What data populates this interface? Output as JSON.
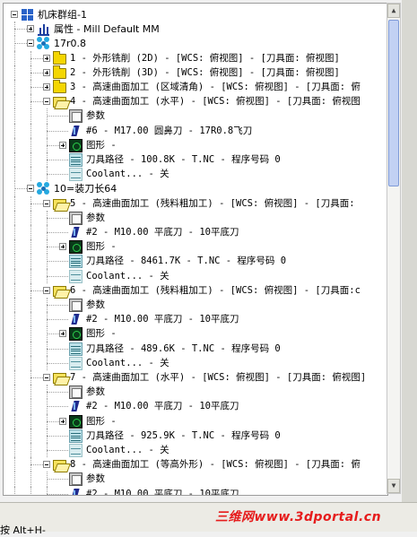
{
  "tree": {
    "rows": [
      {
        "level": 0,
        "toggle": "minus",
        "icon": "group",
        "label": "机床群组-1",
        "font": "sans"
      },
      {
        "level": 1,
        "toggle": "plus",
        "icon": "props",
        "label": "属性 - Mill Default MM",
        "font": "sans"
      },
      {
        "level": 1,
        "toggle": "minus",
        "icon": "tool",
        "label": "17r0.8",
        "font": "sans"
      },
      {
        "level": 2,
        "toggle": "plus",
        "icon": "folder",
        "label": "1 - 外形铣削 (2D) - [WCS: 俯视图] - [刀具面: 俯视图]"
      },
      {
        "level": 2,
        "toggle": "plus",
        "icon": "folder",
        "label": "2 - 外形铣削 (3D) - [WCS: 俯视图] - [刀具面: 俯视图]"
      },
      {
        "level": 2,
        "toggle": "plus",
        "icon": "folder",
        "label": "3 - 高速曲面加工 (区域清角) - [WCS: 俯视图] - [刀具面: 俯"
      },
      {
        "level": 2,
        "toggle": "minus",
        "icon": "folder-open",
        "label": "4 - 高速曲面加工 (水平) - [WCS: 俯视图] - [刀具面: 俯视图"
      },
      {
        "level": 3,
        "toggle": "none",
        "icon": "params",
        "label": "参数"
      },
      {
        "level": 3,
        "toggle": "none",
        "icon": "drill",
        "label": "#6 - M17.00 圆鼻刀 - 17R0.8飞刀"
      },
      {
        "level": 3,
        "toggle": "plus",
        "icon": "geom",
        "label": "图形 -"
      },
      {
        "level": 3,
        "toggle": "none",
        "icon": "path",
        "label": "刀具路径 - 100.8K - T.NC - 程序号码 0"
      },
      {
        "level": 3,
        "toggle": "none",
        "icon": "coolant",
        "label": "Coolant... - 关"
      },
      {
        "level": 1,
        "toggle": "minus",
        "icon": "tool",
        "label": "10=装刀长64",
        "font": "sans"
      },
      {
        "level": 2,
        "toggle": "minus",
        "icon": "folder-open",
        "label": "5 - 高速曲面加工 (残料粗加工) - [WCS: 俯视图] - [刀具面:"
      },
      {
        "level": 3,
        "toggle": "none",
        "icon": "params",
        "label": "参数"
      },
      {
        "level": 3,
        "toggle": "none",
        "icon": "drill",
        "label": "#2 - M10.00 平底刀 - 10平底刀"
      },
      {
        "level": 3,
        "toggle": "plus",
        "icon": "geom",
        "label": "图形 -"
      },
      {
        "level": 3,
        "toggle": "none",
        "icon": "path",
        "label": "刀具路径 - 8461.7K - T.NC - 程序号码 0"
      },
      {
        "level": 3,
        "toggle": "none",
        "icon": "coolant",
        "label": "Coolant... - 关"
      },
      {
        "level": 2,
        "toggle": "minus",
        "icon": "folder-open",
        "label": "6 - 高速曲面加工 (残料粗加工) - [WCS: 俯视图] - [刀具面:c"
      },
      {
        "level": 3,
        "toggle": "none",
        "icon": "params",
        "label": "参数"
      },
      {
        "level": 3,
        "toggle": "none",
        "icon": "drill",
        "label": "#2 - M10.00 平底刀 - 10平底刀"
      },
      {
        "level": 3,
        "toggle": "plus",
        "icon": "geom",
        "label": "图形 -"
      },
      {
        "level": 3,
        "toggle": "none",
        "icon": "path",
        "label": "刀具路径 - 489.6K - T.NC - 程序号码 0"
      },
      {
        "level": 3,
        "toggle": "none",
        "icon": "coolant",
        "label": "Coolant... - 关"
      },
      {
        "level": 2,
        "toggle": "minus",
        "icon": "folder-open",
        "label": "7 - 高速曲面加工 (水平) - [WCS: 俯视图] - [刀具面: 俯视图]"
      },
      {
        "level": 3,
        "toggle": "none",
        "icon": "params",
        "label": "参数"
      },
      {
        "level": 3,
        "toggle": "none",
        "icon": "drill",
        "label": "#2 - M10.00 平底刀 - 10平底刀"
      },
      {
        "level": 3,
        "toggle": "plus",
        "icon": "geom",
        "label": "图形 -"
      },
      {
        "level": 3,
        "toggle": "none",
        "icon": "path",
        "label": "刀具路径 - 925.9K - T.NC - 程序号码 0"
      },
      {
        "level": 3,
        "toggle": "none",
        "icon": "coolant",
        "label": "Coolant... - 关"
      },
      {
        "level": 2,
        "toggle": "minus",
        "icon": "folder-open",
        "label": "8 - 高速曲面加工 (等高外形) - [WCS: 俯视图] - [刀具面: 俯"
      },
      {
        "level": 3,
        "toggle": "none",
        "icon": "params",
        "label": "参数"
      },
      {
        "level": 3,
        "toggle": "none",
        "icon": "drill",
        "label": "#2 - M10.00 平底刀 - 10平底刀"
      }
    ]
  },
  "scrollbar": {
    "up_glyph": "▲",
    "down_glyph": "▼"
  },
  "status": {
    "text": "按 Alt+H-"
  },
  "watermark": {
    "text": "三维网www.3dportal.cn"
  },
  "colors": {
    "folder": "#f4d600",
    "tool_icon": "#25a9e0",
    "group_icon": "#2a63c8",
    "watermark": "#e61c1c"
  }
}
